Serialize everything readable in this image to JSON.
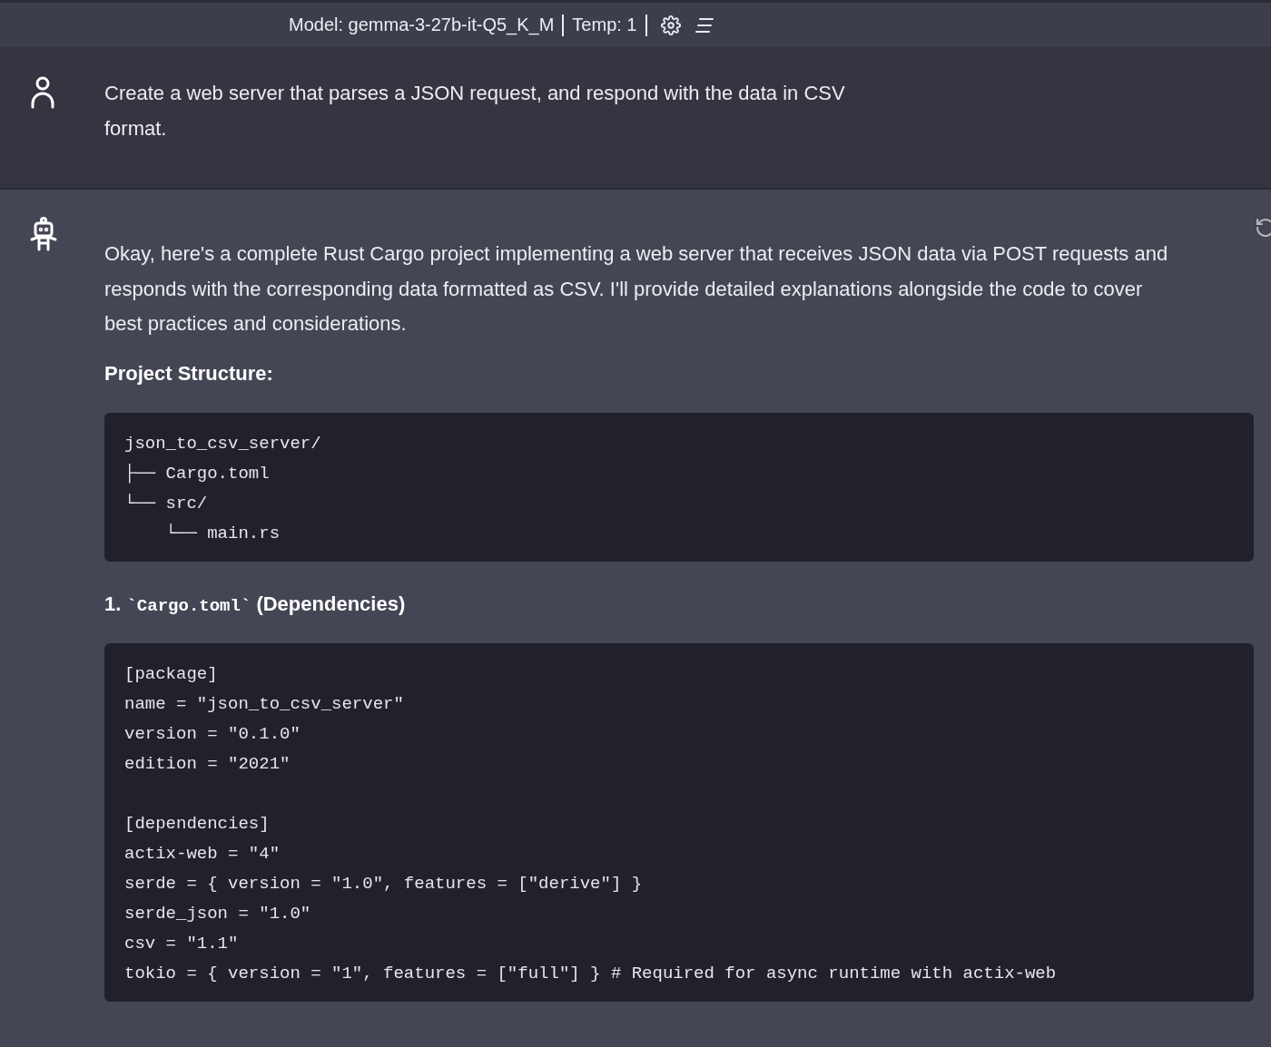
{
  "header": {
    "model": "Model: gemma-3-27b-it-Q5_K_M",
    "temp": "Temp: 1"
  },
  "messages": [
    {
      "kind": "user",
      "blocks": [
        {
          "kind": "paragraph",
          "text": "Create a web server that parses a JSON request, and respond with the data in CSV format."
        }
      ]
    },
    {
      "kind": "assistant",
      "blocks": [
        {
          "kind": "paragraph",
          "text": "Okay, here's a complete Rust Cargo project implementing a web server that receives JSON data via POST requests and responds with the corresponding data formatted as CSV. I'll provide detailed explanations alongside the code to cover best practices and considerations."
        },
        {
          "kind": "heading",
          "parts": [
            {
              "code": false,
              "text": "Project Structure:"
            }
          ]
        },
        {
          "kind": "code",
          "groups": [
            [
              "json_to_csv_server/",
              "├── Cargo.toml",
              "└── src/",
              "    └── main.rs"
            ]
          ]
        },
        {
          "kind": "heading",
          "parts": [
            {
              "code": false,
              "text": "1. "
            },
            {
              "code": true,
              "text": "`Cargo.toml`"
            },
            {
              "code": false,
              "text": " (Dependencies)"
            }
          ]
        },
        {
          "kind": "code",
          "groups": [
            [
              "[package]",
              "name = \"json_to_csv_server\"",
              "version = \"0.1.0\"",
              "edition = \"2021\""
            ],
            [
              "[dependencies]",
              "actix-web = \"4\"",
              "serde = { version = \"1.0\", features = [\"derive\"] }",
              "serde_json = \"1.0\"",
              "csv = \"1.1\"",
              "tokio = { version = \"1\", features = [\"full\"] } # Required for async runtime with actix-web"
            ]
          ]
        }
      ]
    }
  ]
}
